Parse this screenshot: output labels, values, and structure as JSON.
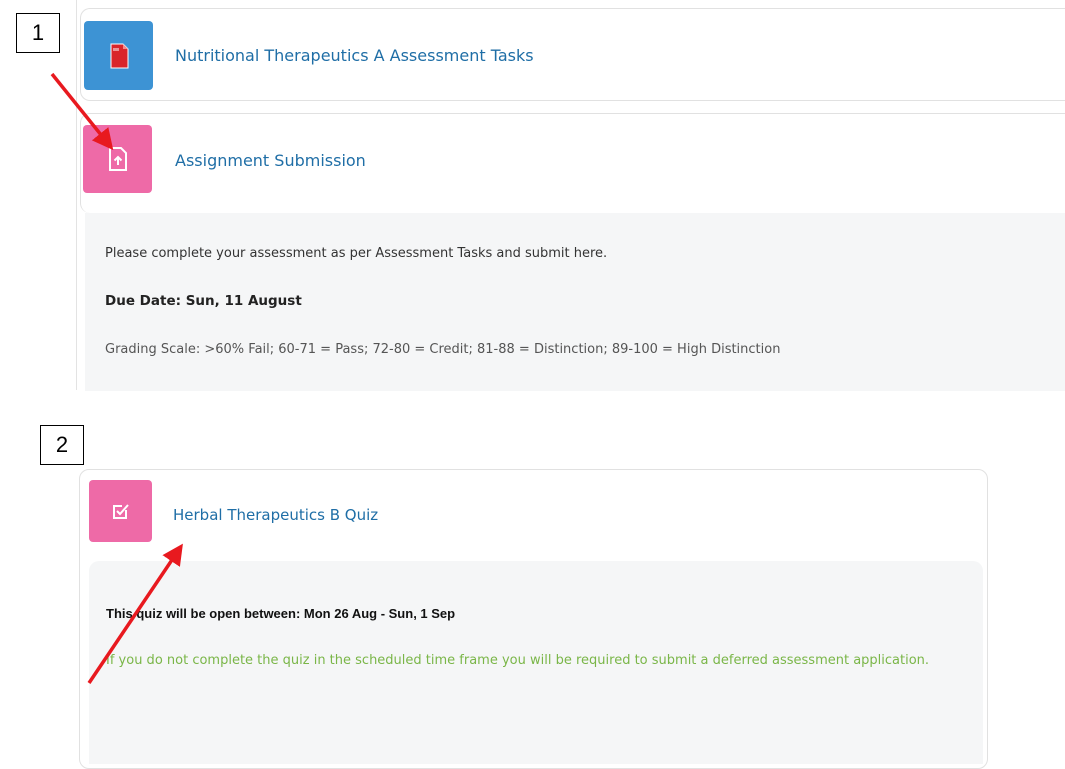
{
  "callouts": [
    "1",
    "2"
  ],
  "section1": {
    "resource": {
      "title": "Nutritional Therapeutics A Assessment Tasks",
      "icon": "pdf-file-icon",
      "icon_color": "#3d93d4"
    },
    "assignment": {
      "title": "Assignment Submission",
      "icon": "upload-file-icon",
      "icon_color": "#ee6aa7",
      "description": "Please complete your assessment as per Assessment Tasks and submit here.",
      "due_date": "Due Date:  Sun, 11 August",
      "grading_scale": "Grading Scale: >60% Fail; 60-71 = Pass; 72-80 = Credit; 81-88 = Distinction; 89-100 = High Distinction"
    }
  },
  "section2": {
    "quiz": {
      "title": "Herbal Therapeutics B Quiz",
      "icon": "checkbox-edit-icon",
      "icon_color": "#ee6aa7",
      "open_between": "This quiz will be open between: Mon 26 Aug - Sun, 1 Sep",
      "warning": "If you do not complete the quiz in the scheduled time frame you will be required to submit a deferred assessment application.",
      "warning_color": "#7ab648"
    }
  },
  "annotation_arrow_color": "#e8191f"
}
